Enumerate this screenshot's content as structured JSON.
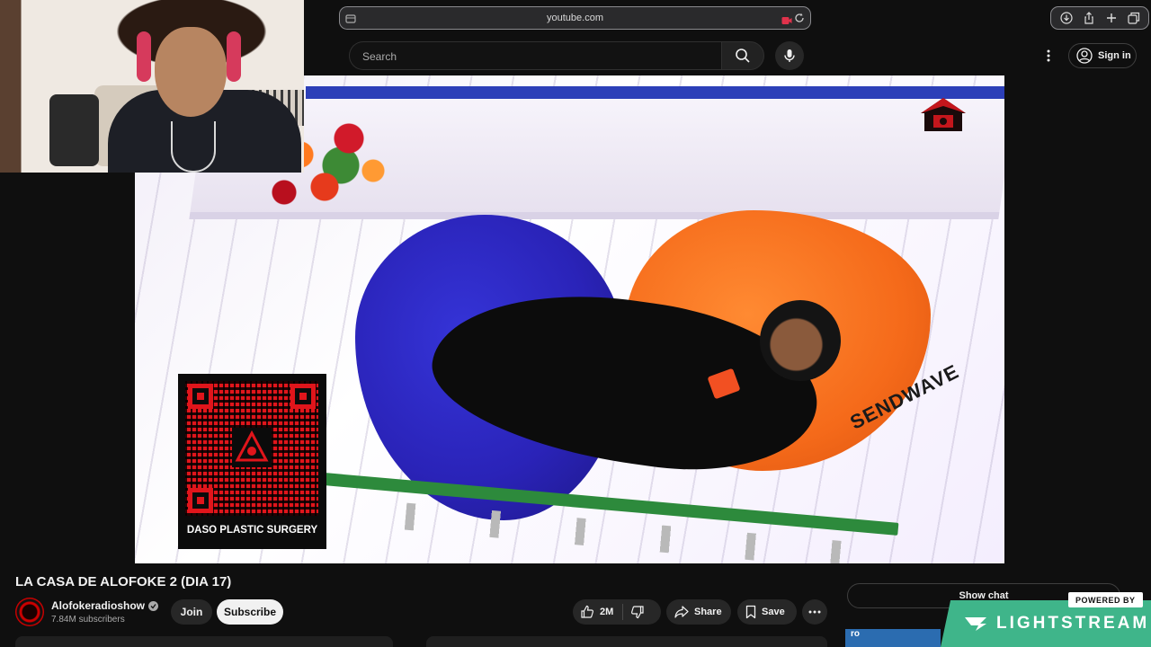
{
  "browser": {
    "url": "youtube.com"
  },
  "header": {
    "search_placeholder": "Search",
    "sign_in_label": "Sign in"
  },
  "video": {
    "qr_caption": "DASO PLASTIC SURGERY",
    "brand_text": "SENDWAVE"
  },
  "details": {
    "title": "LA CASA DE ALOFOKE 2 (DIA 17)",
    "channel_name": "Alofokeradioshow",
    "subscribers": "7.84M subscribers",
    "join_label": "Join",
    "subscribe_label": "Subscribe",
    "like_count": "2M",
    "share_label": "Share",
    "save_label": "Save"
  },
  "sidebar": {
    "show_chat_label": "Show chat",
    "thumbnail_text": "ro"
  },
  "overlay": {
    "powered_by": "POWERED BY",
    "brand": "LIGHTSTREAM"
  },
  "colors": {
    "background": "#0f0f0f",
    "lightstream_green": "#3fb58a",
    "qr_red": "#e0151b"
  },
  "icons": [
    "site-icon",
    "camera-icon",
    "reload-icon",
    "download-icon",
    "share-icon",
    "plus-icon",
    "tabs-icon",
    "search-icon",
    "mic-icon",
    "kebab-icon",
    "account-icon",
    "verified-icon",
    "like-icon",
    "dislike-icon",
    "share-arrow-icon",
    "save-icon",
    "more-icon",
    "lightstream-logo-icon"
  ]
}
